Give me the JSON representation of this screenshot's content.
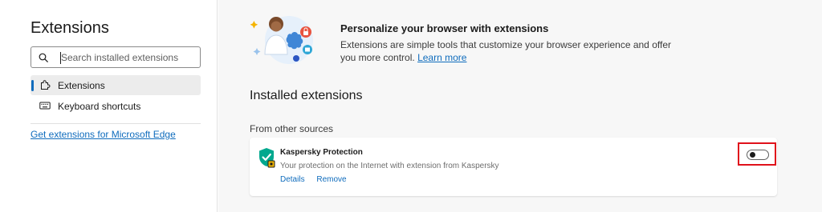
{
  "sidebar": {
    "title": "Extensions",
    "search": {
      "placeholder": "Search installed extensions",
      "value": ""
    },
    "items": [
      {
        "label": "Extensions",
        "icon": "puzzle-icon",
        "active": true
      },
      {
        "label": "Keyboard shortcuts",
        "icon": "keyboard-icon",
        "active": false
      }
    ],
    "get_extensions_link": "Get extensions for Microsoft Edge"
  },
  "banner": {
    "title": "Personalize your browser with extensions",
    "description": "Extensions are simple tools that customize your browser experience and offer you more control.",
    "learn_more": "Learn more"
  },
  "installed": {
    "title": "Installed extensions",
    "source_heading": "From other sources",
    "extensions": [
      {
        "name": "Kaspersky Protection",
        "description": "Your protection on the Internet with extension from Kaspersky",
        "details_label": "Details",
        "remove_label": "Remove",
        "enabled": false,
        "icon": "kaspersky-shield-icon"
      }
    ]
  },
  "colors": {
    "accent": "#0f6cbd",
    "highlight": "#e0111b",
    "brand_green": "#00a88e"
  }
}
